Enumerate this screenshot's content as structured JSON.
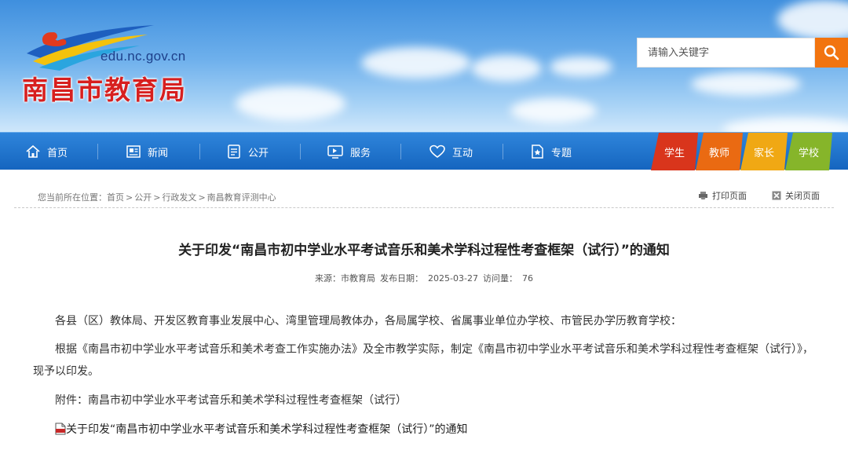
{
  "site": {
    "domain": "edu.nc.gov.cn",
    "title": "南昌市教育局"
  },
  "search": {
    "placeholder": "请输入关键字"
  },
  "nav": {
    "items": [
      {
        "label": "首页",
        "icon": "home-icon"
      },
      {
        "label": "新闻",
        "icon": "newspaper-icon"
      },
      {
        "label": "公开",
        "icon": "document-list-icon"
      },
      {
        "label": "服务",
        "icon": "monitor-icon"
      },
      {
        "label": "互动",
        "icon": "heart-icon"
      },
      {
        "label": "专题",
        "icon": "star-folder-icon"
      }
    ],
    "roles": [
      {
        "label": "学生",
        "color": "#d9351c"
      },
      {
        "label": "教师",
        "color": "#ea6a12"
      },
      {
        "label": "家长",
        "color": "#f0a814"
      },
      {
        "label": "学校",
        "color": "#86b52a"
      }
    ]
  },
  "breadcrumb": {
    "prefix": "您当前所在位置：",
    "items": [
      "首页",
      "公开",
      "行政发文",
      "南昌教育评测中心"
    ],
    "separator": ">"
  },
  "tools": {
    "print_label": "打印页面",
    "close_label": "关闭页面"
  },
  "article": {
    "title": "关于印发“南昌市初中学业水平考试音乐和美术学科过程性考查框架（试行）”的通知",
    "source_label": "来源：市教育局",
    "date_label": "发布日期：",
    "date": "2025-03-27",
    "views_label": "访问量：",
    "views": "76",
    "paragraphs": [
      "各县（区）教体局、开发区教育事业发展中心、湾里管理局教体办，各局属学校、省属事业单位办学校、市管民办学历教育学校：",
      "根据《南昌市初中学业水平考试音乐和美术考查工作实施办法》及全市教学实际，制定《南昌市初中学业水平考试音乐和美术学科过程性考查框架（试行）》，现予以印发。",
      "附件：南昌市初中学业水平考试音乐和美术学科过程性考查框架（试行）"
    ],
    "attachment": "关于印发“南昌市初中学业水平考试音乐和美术学科过程性考查框架（试行）”的通知"
  },
  "colors": {
    "nav_blue": "#1f74cf",
    "search_orange": "#f2740f",
    "title_red": "#d71f1f"
  }
}
